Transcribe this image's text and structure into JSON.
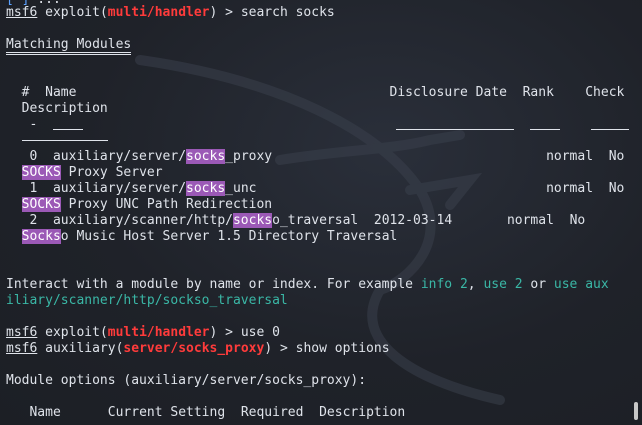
{
  "prompt": {
    "host": "msf6",
    "ctx_exploit": "exploit",
    "ctx_aux": "auxiliary",
    "mod_handler": "multi/handler",
    "mod_socks": "server/socks_proxy"
  },
  "top_line": {
    "tail": ") > search socks"
  },
  "matching": {
    "title": "Matching Modules"
  },
  "header": {
    "num": "#",
    "name": "Name",
    "date": "Disclosure Date",
    "rank": "Rank",
    "check": "Check",
    "desc": "Description",
    "dash": "-"
  },
  "rows": [
    {
      "num": "0",
      "path_pre": "auxiliary/server/",
      "path_hl": "socks",
      "path_post": "_proxy",
      "date": "",
      "rank": "normal",
      "check": "No",
      "desc_hl": "SOCKS",
      "desc_post": " Proxy Server"
    },
    {
      "num": "1",
      "path_pre": "auxiliary/server/",
      "path_hl": "socks",
      "path_post": "_unc",
      "date": "",
      "rank": "normal",
      "check": "No",
      "desc_hl": "SOCKS",
      "desc_post": " Proxy UNC Path Redirection"
    },
    {
      "num": "2",
      "path_pre": "auxiliary/scanner/http/",
      "path_hl": "socks",
      "path_post": "o_traversal",
      "date": "2012-03-14",
      "rank": "normal",
      "check": "No",
      "desc_hl": "Socks",
      "desc_post": "o Music Host Server 1.5 Directory Traversal"
    }
  ],
  "interact": {
    "pre": "Interact with a module by name or index. For example ",
    "info": "info 2",
    ", ": ", ",
    "use2": "use 2",
    "or": " or ",
    "use_path1": "use aux",
    "use_path2": "iliary/scanner/http/sockso_traversal"
  },
  "cmd1": {
    "tail": ") > use 0"
  },
  "cmd2": {
    "tail": ") > show options"
  },
  "options": {
    "title": "Module options (auxiliary/server/socks_proxy):"
  },
  "opt_header": {
    "name": "Name",
    "current": "Current Setting",
    "required": "Required",
    "desc": "Description"
  },
  "colors": {
    "background": "#1f2229",
    "text": "#dfe3ea",
    "red": "#ff3b3b",
    "highlight": "#9b59b6",
    "teal": "#3ab7a6"
  }
}
